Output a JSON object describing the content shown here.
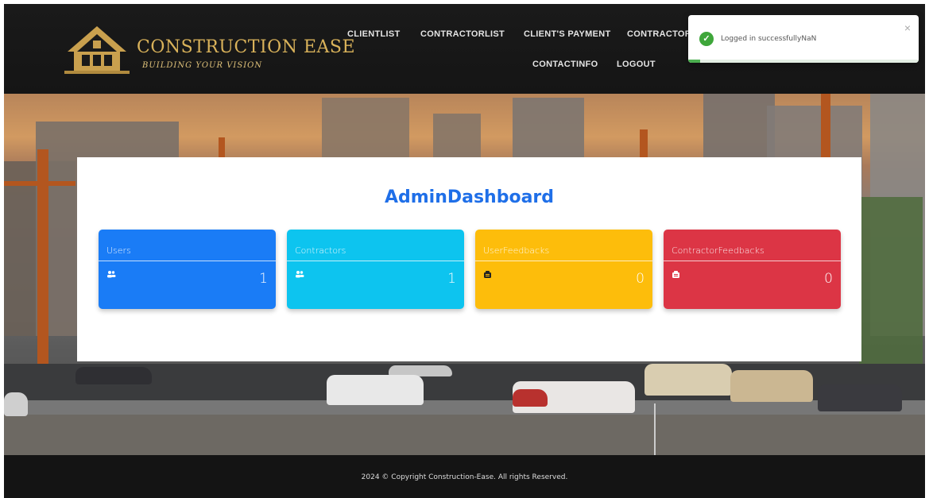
{
  "brand": {
    "name": "CONSTRUCTION EASE",
    "tagline": "BUILDING YOUR VISION"
  },
  "nav": {
    "items": [
      {
        "label": "CLIENTLIST"
      },
      {
        "label": "CONTRACTORLIST"
      },
      {
        "label": "CLIENT'S PAYMENT"
      },
      {
        "label": "CONTRACTORS"
      },
      {
        "label": "CONTACTINFO"
      },
      {
        "label": "LOGOUT"
      }
    ]
  },
  "dashboard": {
    "title": "AdminDashboard",
    "cards": [
      {
        "label": "Users",
        "value": "1",
        "icon": "users-icon",
        "color": "#1a7cf6"
      },
      {
        "label": "Contractors",
        "value": "1",
        "icon": "users-icon",
        "color": "#0dc4ef"
      },
      {
        "label": "UserFeedbacks",
        "value": "0",
        "icon": "feedback-icon",
        "color": "#fdbd0b"
      },
      {
        "label": "ContractorFeedbacks",
        "value": "0",
        "icon": "feedback-icon",
        "color": "#dc3545"
      }
    ]
  },
  "footer": {
    "copyright": "2024 © Copyright Construction-Ease. All rights Reserved."
  },
  "toast": {
    "message": "Logged in successfullyNaN",
    "close": "×",
    "progress": 0.05
  },
  "colors": {
    "accent": "#1f6fe8",
    "gold": "#d9b25a",
    "header": "#1a1a1a"
  }
}
